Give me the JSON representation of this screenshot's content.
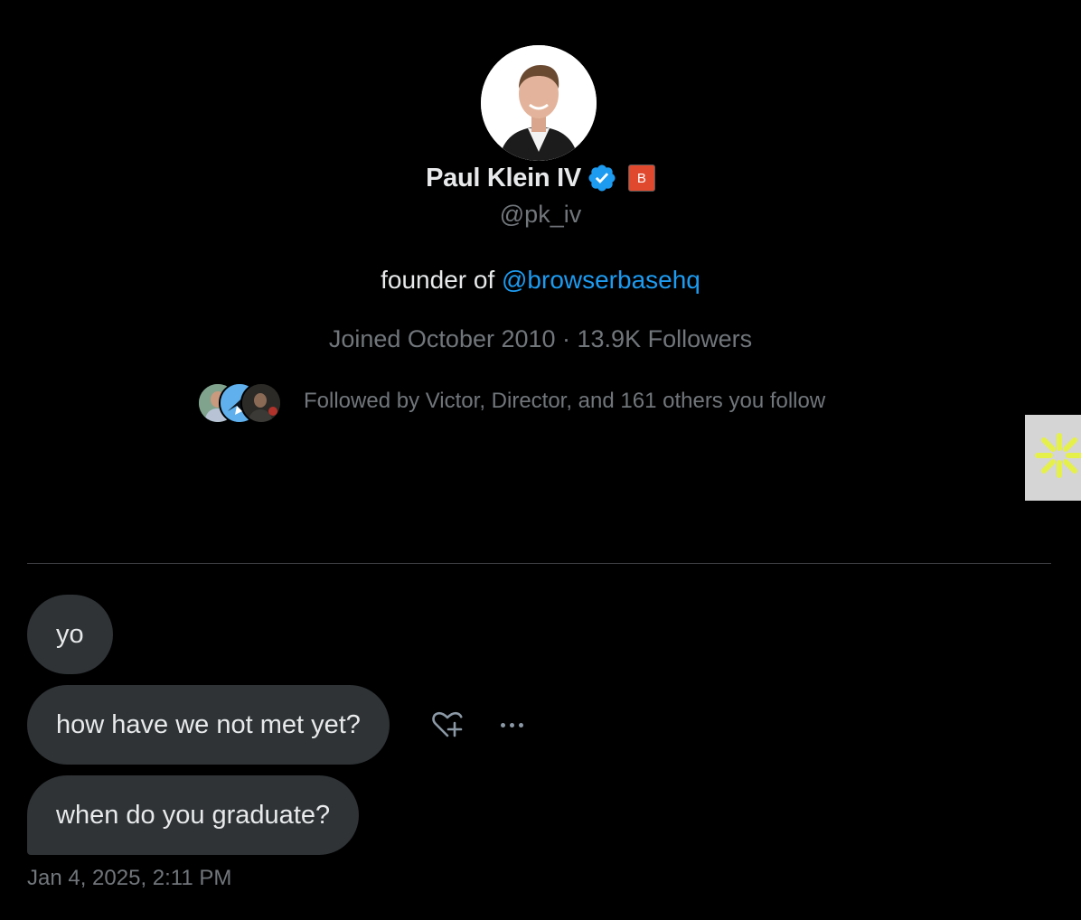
{
  "profile": {
    "name": "Paul Klein IV",
    "affiliate_badge_letter": "B",
    "handle": "@pk_iv",
    "bio_prefix": "founder of ",
    "bio_link": "@browserbasehq",
    "meta": "Joined October 2010 · 13.9K Followers",
    "followed_by": "Followed by Victor, Director, and 161 others you follow"
  },
  "messages": [
    {
      "text": "yo"
    },
    {
      "text": "how have we not met yet?"
    },
    {
      "text": "when do you graduate?"
    }
  ],
  "timestamp": "Jan 4, 2025, 2:11 PM",
  "icons": {
    "verified": "verified-badge-icon",
    "react": "add-reaction-icon",
    "more": "more-options-icon",
    "side_widget": "spark-icon"
  },
  "colors": {
    "background": "#000000",
    "text_primary": "#e7e9ea",
    "text_secondary": "#71767b",
    "link": "#1d9bf0",
    "bubble": "#2f3336",
    "verified": "#1d9bf0",
    "affiliate_badge": "#e0492d",
    "widget_spark": "#e6f04a"
  }
}
